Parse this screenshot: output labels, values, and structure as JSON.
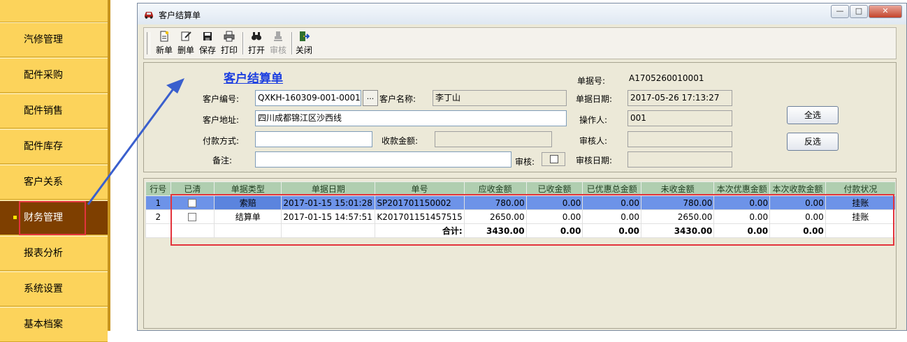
{
  "nav": {
    "items": [
      {
        "label": "汽修管理"
      },
      {
        "label": "配件采购"
      },
      {
        "label": "配件销售"
      },
      {
        "label": "配件库存"
      },
      {
        "label": "客户关系"
      },
      {
        "label": "财务管理",
        "active": true
      },
      {
        "label": "报表分析"
      },
      {
        "label": "系统设置"
      },
      {
        "label": "基本档案"
      }
    ]
  },
  "window": {
    "title": "客户结算单",
    "minimize_label": "—",
    "restore_label": "□",
    "close_label": "✕"
  },
  "toolbar": {
    "new_label": "新单",
    "delete_label": "删单",
    "save_label": "保存",
    "print_label": "打印",
    "open_label": "打开",
    "audit_label": "审核",
    "close_label": "关闭"
  },
  "form": {
    "doc_title": "客户结算单",
    "doc_no_label": "单据号:",
    "doc_no_value": "A1705260010001",
    "customer_code_label": "客户编号:",
    "customer_code_value": "QXKH-160309-001-0001",
    "lookup_label": "...",
    "customer_name_label": "客户名称:",
    "customer_name_value": "李丁山",
    "doc_date_label": "单据日期:",
    "doc_date_value": "2017-05-26 17:13:27",
    "address_label": "客户地址:",
    "address_value": "四川成都锦江区沙西线",
    "operator_label": "操作人:",
    "operator_value": "001",
    "payment_method_label": "付款方式:",
    "payment_method_value": "",
    "received_amount_label": "收款金额:",
    "received_amount_value": "",
    "auditor_label": "审核人:",
    "auditor_value": "",
    "remarks_label": "备注:",
    "remarks_value": "",
    "audit_check_label": "审核:",
    "audit_date_label": "审核日期:",
    "audit_date_value": "",
    "select_all_label": "全选",
    "invert_select_label": "反选"
  },
  "grid": {
    "columns": [
      "行号",
      "已清",
      "单据类型",
      "单据日期",
      "单号",
      "应收金额",
      "已收金额",
      "已优惠总金额",
      "未收金额",
      "本次优惠金额",
      "本次收款金额",
      "付款状况"
    ],
    "rows": [
      {
        "no": "1",
        "type": "索赔",
        "date": "2017-01-15 15:01:28",
        "order_no": "SP201701150002",
        "receivable": "780.00",
        "received": "0.00",
        "discounted": "0.00",
        "unpaid": "780.00",
        "this_discount": "0.00",
        "this_payment": "0.00",
        "status": "挂账",
        "selected": true
      },
      {
        "no": "2",
        "type": "结算单",
        "date": "2017-01-15 14:57:51",
        "order_no": "K201701151457515",
        "receivable": "2650.00",
        "received": "0.00",
        "discounted": "0.00",
        "unpaid": "2650.00",
        "this_discount": "0.00",
        "this_payment": "0.00",
        "status": "挂账",
        "selected": false
      }
    ],
    "total": {
      "label": "合计:",
      "receivable": "3430.00",
      "received": "0.00",
      "discounted": "0.00",
      "unpaid": "3430.00",
      "this_discount": "0.00",
      "this_payment": "0.00"
    }
  },
  "colors": {
    "nav_bg": "#fcd35b",
    "nav_active": "#7e3f00",
    "doc_title": "#1c3fe0",
    "header_green": "#b0ceb0",
    "selected_row": "#6d93e8",
    "annotation_red": "#e3343c",
    "annotation_arrow": "#3a5fcd"
  }
}
